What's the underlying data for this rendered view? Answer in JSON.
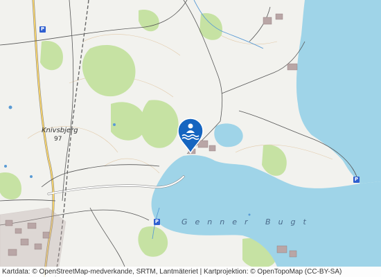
{
  "map": {
    "place_label": "Knivsbjerg",
    "elevation_label": "97",
    "bay_label": "Genner Bugt",
    "marker_icon": "swimming-icon",
    "parking_label": "P",
    "colors": {
      "water": "#9fd4e8",
      "forest": "#c6e2a3",
      "land": "#f2f2ee",
      "road": "#ffffff",
      "road_casing": "#888888",
      "marker": "#1565c0"
    }
  },
  "attribution": "Kartdata: © OpenStreetMap-medverkande, SRTM, Lantmäteriet | Kartprojektion: © OpenTopoMap (CC-BY-SA)"
}
